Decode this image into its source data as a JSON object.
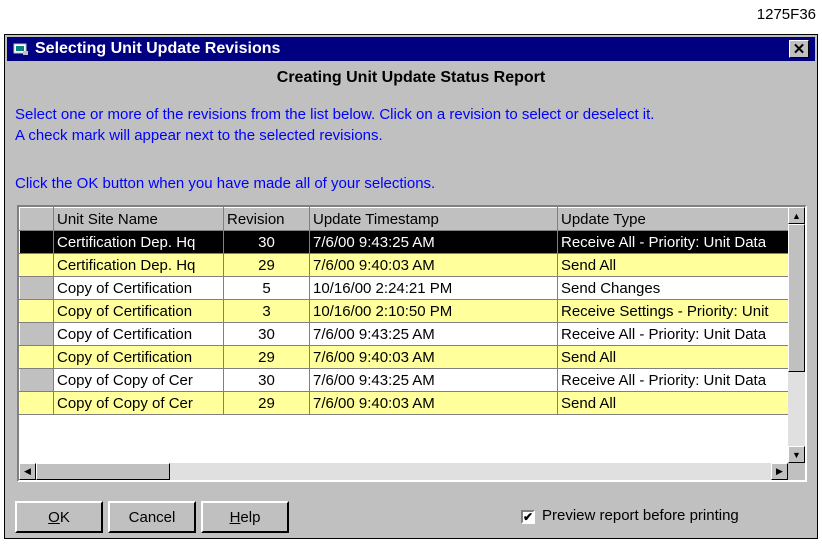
{
  "figure_id": "1275F36",
  "window": {
    "title": "Selecting Unit Update Revisions",
    "close_label": "✕"
  },
  "heading": "Creating Unit Update Status Report",
  "instructions": {
    "line1": "Select one or more of the revisions from the list below.  Click on a revision to select or deselect it.",
    "line2": "A check mark will appear next to the selected revisions.",
    "line3": "Click the OK button when you have made all of your selections."
  },
  "grid": {
    "columns": [
      "Unit Site Name",
      "Revision",
      "Update Timestamp",
      "Update Type"
    ],
    "rows": [
      {
        "site": "Certification Dep. Hq",
        "revision": "30",
        "timestamp": "7/6/00 9:43:25 AM",
        "type": "Receive All - Priority: Unit Data",
        "style": "selected"
      },
      {
        "site": "Certification Dep. Hq",
        "revision": "29",
        "timestamp": "7/6/00 9:40:03 AM",
        "type": "Send All",
        "style": "yellow"
      },
      {
        "site": "Copy of Certification",
        "revision": "5",
        "timestamp": "10/16/00 2:24:21 PM",
        "type": "Send Changes",
        "style": "white"
      },
      {
        "site": "Copy of Certification",
        "revision": "3",
        "timestamp": "10/16/00 2:10:50 PM",
        "type": "Receive Settings - Priority: Unit",
        "style": "yellow"
      },
      {
        "site": "Copy of Certification",
        "revision": "30",
        "timestamp": "7/6/00 9:43:25 AM",
        "type": "Receive All - Priority: Unit Data",
        "style": "white"
      },
      {
        "site": "Copy of Certification",
        "revision": "29",
        "timestamp": "7/6/00 9:40:03 AM",
        "type": "Send All",
        "style": "yellow"
      },
      {
        "site": "Copy of Copy of Cer",
        "revision": "30",
        "timestamp": "7/6/00 9:43:25 AM",
        "type": "Receive All - Priority: Unit Data",
        "style": "white"
      },
      {
        "site": "Copy of Copy of Cer",
        "revision": "29",
        "timestamp": "7/6/00 9:40:03 AM",
        "type": "Send All",
        "style": "yellow"
      }
    ]
  },
  "buttons": {
    "ok": {
      "accel": "O",
      "rest": "K"
    },
    "cancel": "Cancel",
    "help": {
      "accel": "H",
      "rest": "elp"
    }
  },
  "preview_checkbox": {
    "label": "Preview report before printing",
    "checked": true
  },
  "icons": [
    "app-icon",
    "close-icon",
    "scroll-up-arrow-icon",
    "scroll-down-arrow-icon",
    "scroll-left-arrow-icon",
    "scroll-right-arrow-icon",
    "checkmark-icon"
  ],
  "colors": {
    "titlebar": "#000080",
    "instruction_text": "#0000ff",
    "highlight_row": "#ffff9c",
    "selected_row": "#000000"
  }
}
